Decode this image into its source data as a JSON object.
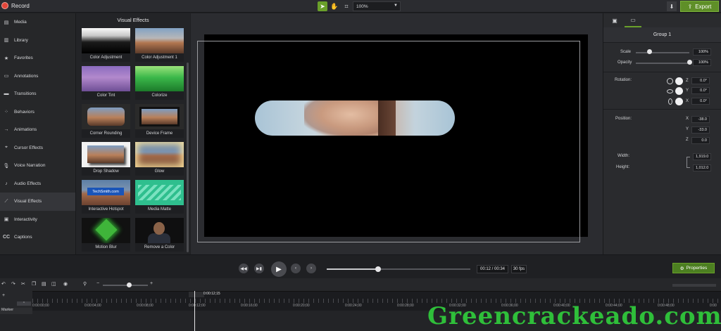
{
  "app": {
    "record_label": "Record"
  },
  "toolbar": {
    "zoom": "100%",
    "export_label": "Export"
  },
  "sidebar": {
    "items": [
      {
        "label": "Media",
        "icon": "film-icon"
      },
      {
        "label": "Library",
        "icon": "library-icon"
      },
      {
        "label": "Favorites",
        "icon": "star-icon"
      },
      {
        "label": "Annotations",
        "icon": "annotation-icon"
      },
      {
        "label": "Transitions",
        "icon": "transition-icon"
      },
      {
        "label": "Behaviors",
        "icon": "behavior-icon"
      },
      {
        "label": "Animations",
        "icon": "animation-icon"
      },
      {
        "label": "Cursor Effects",
        "icon": "cursor-icon"
      },
      {
        "label": "Voice Narration",
        "icon": "microphone-icon"
      },
      {
        "label": "Audio Effects",
        "icon": "audio-icon"
      },
      {
        "label": "Visual Effects",
        "icon": "wand-icon"
      },
      {
        "label": "Interactivity",
        "icon": "interactivity-icon"
      },
      {
        "label": "Captions",
        "icon": "captions-icon"
      }
    ],
    "active_index": 10
  },
  "effects_panel": {
    "title": "Visual Effects",
    "cards": [
      {
        "label": "Color Adjustment"
      },
      {
        "label": "Color Adjustment 1"
      },
      {
        "label": "Color Tint"
      },
      {
        "label": "Colorize"
      },
      {
        "label": "Corner Rounding"
      },
      {
        "label": "Device Frame"
      },
      {
        "label": "Drop Shadow"
      },
      {
        "label": "Glow"
      },
      {
        "label": "Interactive Hotspot",
        "badge": "TechSmith.com"
      },
      {
        "label": "Media Matte"
      },
      {
        "label": "Motion Blur"
      },
      {
        "label": "Remove a Color"
      }
    ]
  },
  "properties": {
    "group_title": "Group 1",
    "scale": {
      "label": "Scale",
      "value": "100%",
      "level": 0.25
    },
    "opacity": {
      "label": "Opacity",
      "value": "100%",
      "level": 1.0
    },
    "rotation": {
      "label": "Rotation:",
      "z": "0.0°",
      "y": "0.0°",
      "x": "0.0°"
    },
    "position": {
      "label": "Position:",
      "x": "-38.0",
      "y": "-33.0",
      "z": "0.0"
    },
    "width": {
      "label": "Width:",
      "value": "1,919.0"
    },
    "height": {
      "label": "Height:",
      "value": "1,012.0"
    },
    "axis_labels": {
      "x": "X",
      "y": "Y",
      "z": "Z"
    }
  },
  "playback": {
    "time": "00:12 / 00:34",
    "fps": "30 fps",
    "progress": 0.36,
    "properties_label": "Properties"
  },
  "timeline": {
    "playhead_time": "0:00:12;15",
    "marker_label": "Marker",
    "ticks": [
      "0:00:00;00",
      "0:00:04;00",
      "0:00:08;00",
      "0:00:12;00",
      "0:00:16;00",
      "0:00:20;00",
      "0:00:24;00",
      "0:00:28;00",
      "0:00:32;00",
      "0:00:36;00",
      "0:00:40;00",
      "0:00:44;00",
      "0:00:48;00",
      "0:00"
    ]
  },
  "watermark": "Greencrackeado.com",
  "colors": {
    "accent": "#6aa02a",
    "record": "#e2463a",
    "export": "#5f8f28"
  }
}
